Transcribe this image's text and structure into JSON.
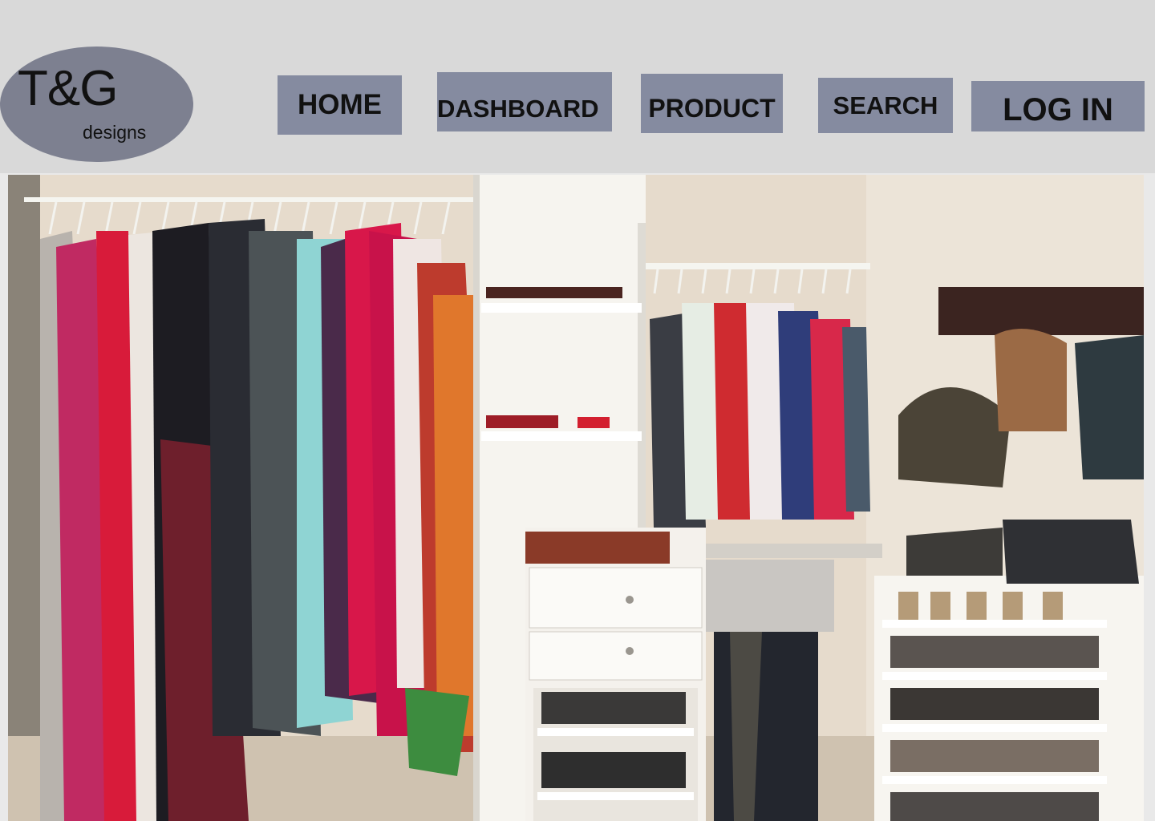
{
  "logo": {
    "title": "T&G",
    "subtitle": "designs"
  },
  "nav": {
    "home": "HOME",
    "dashboard": "DASHBOARD",
    "product": "PRODUCT",
    "search": "SEARCH",
    "login": "LOG IN"
  },
  "colors": {
    "header_bg": "#d9d9d9",
    "nav_button": "#858ba0",
    "logo_bg": "#7d8090"
  },
  "hero": {
    "image": "walk-in-closet-photo"
  }
}
